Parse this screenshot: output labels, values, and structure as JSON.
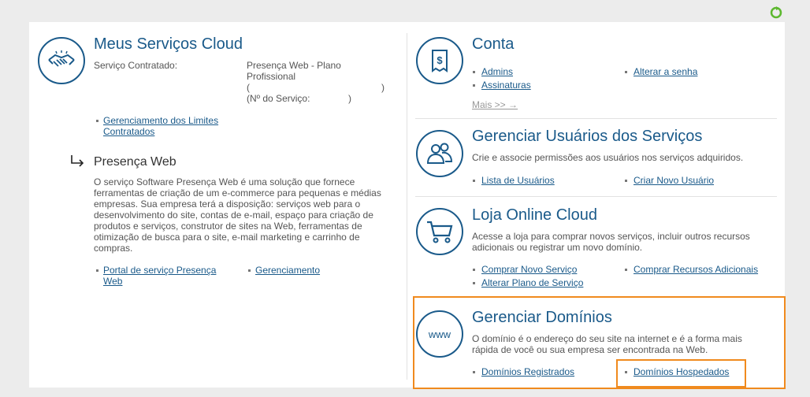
{
  "colors": {
    "accent": "#1a5a8a",
    "highlight": "#f08a1e"
  },
  "left": {
    "title": "Meus Serviços Cloud",
    "service_label": "Serviço Contratado:",
    "service_value_1": "Presença Web - Plano",
    "service_value_2": "Profissional",
    "paren_open": "(",
    "paren_close": ")",
    "service_no_label": "(Nº do Serviço:",
    "service_no_close": ")",
    "link_limits_1": "Gerenciamento dos Limites",
    "link_limits_2": "Contratados",
    "section_title": "Presença Web",
    "description": "O serviço Software Presença Web é uma solução que fornece ferramentas de criação de um e-commerce para pequenas e médias empresas. Sua empresa terá a disposição: serviços web para o desenvolvimento do site, contas de e-mail, espaço para criação de produtos e serviços, construtor de sites na Web, ferramentas de otimização de busca para o site, e-mail marketing e carrinho de compras.",
    "link_portal_1": "Portal de serviço Presença",
    "link_portal_2": "Web",
    "link_manage": "Gerenciamento"
  },
  "account": {
    "title": "Conta",
    "link_admins": "Admins",
    "link_subscriptions": "Assinaturas",
    "link_password": "Alterar a senha",
    "more": "Mais >> →"
  },
  "users": {
    "title": "Gerenciar Usuários dos Serviços",
    "description": "Crie e associe permissões aos usuários nos serviços adquiridos.",
    "link_list": "Lista de Usuários",
    "link_new": "Criar Novo Usuário"
  },
  "store": {
    "title": "Loja Online Cloud",
    "description_1": "Acesse a loja para comprar novos serviços, incluir outros recursos",
    "description_2": "adicionais ou registrar um novo domínio.",
    "link_buy": "Comprar Novo Serviço",
    "link_change": "Alterar Plano de Serviço",
    "link_resources": "Comprar Recursos Adicionais"
  },
  "domains": {
    "title": "Gerenciar Domínios",
    "icon_text": "www",
    "description_1": "O domínio é o endereço do seu site na internet e é a forma mais",
    "description_2": "rápida de você ou sua empresa ser encontrada na Web.",
    "link_registered": "Domínios Registrados",
    "link_hosted": "Domínios Hospedados"
  }
}
